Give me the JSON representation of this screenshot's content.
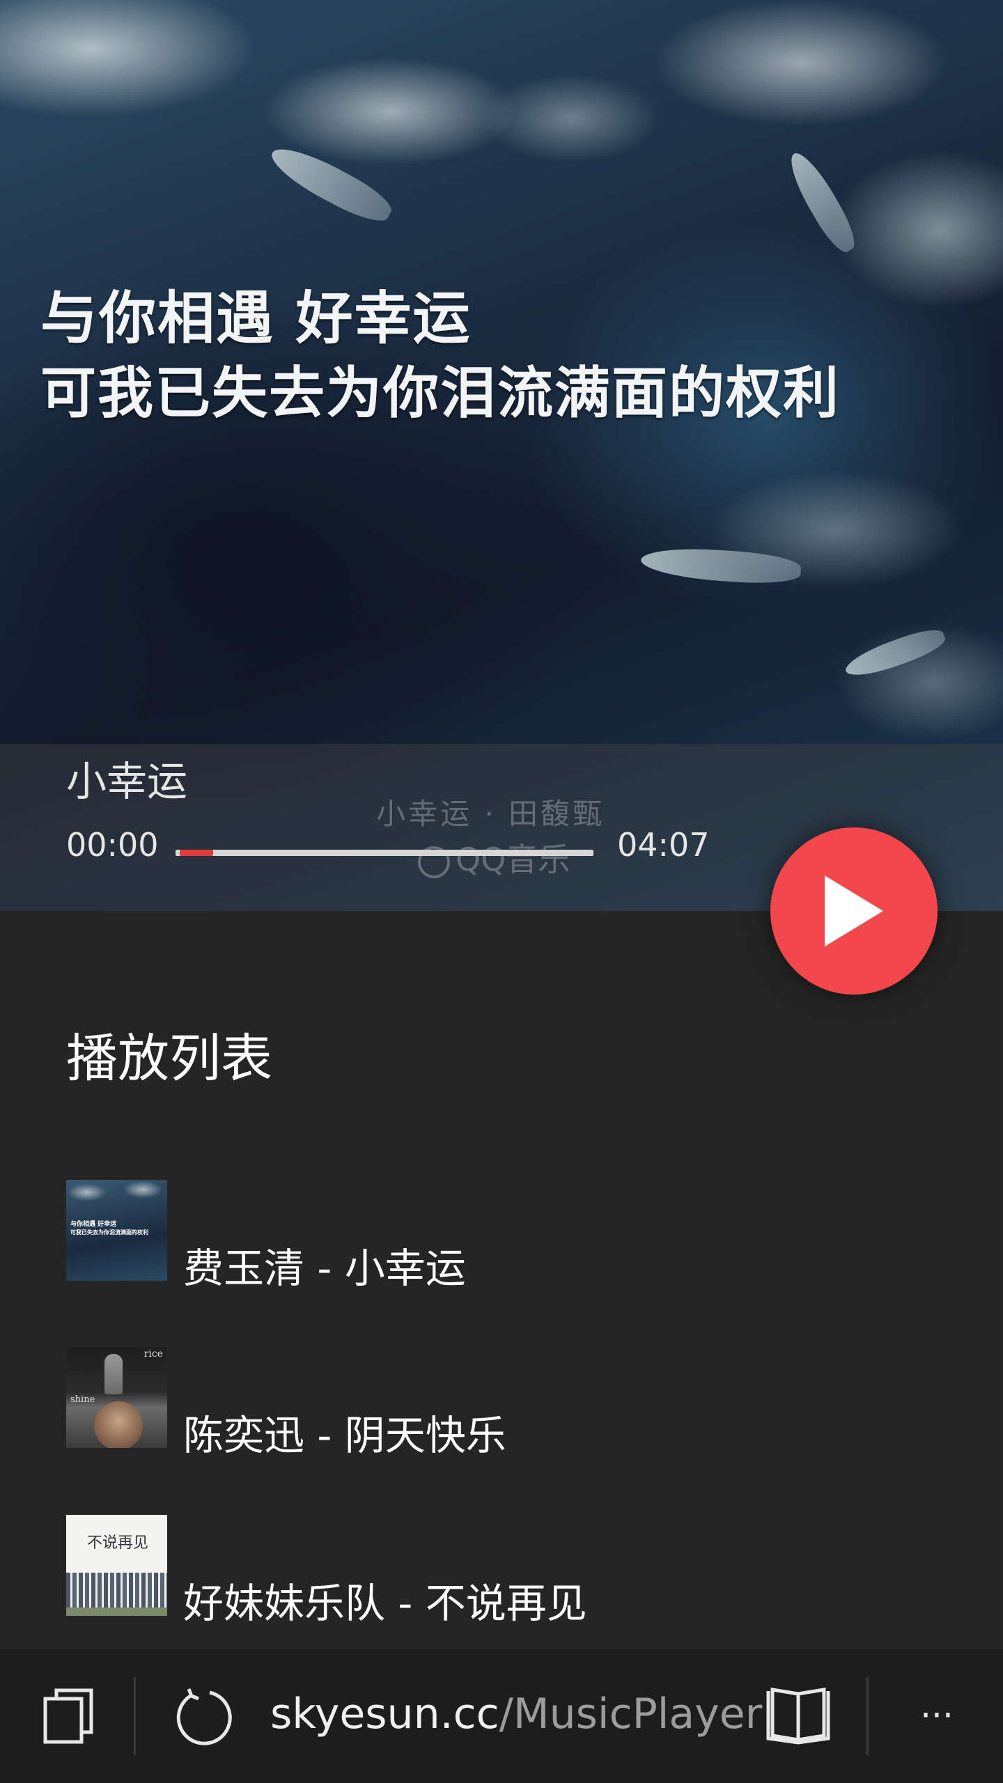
{
  "hero": {
    "lyric_line1": "与你相遇 好幸运",
    "lyric_line2": "可我已失去为你泪流满面的权利",
    "watermark_title": "小幸运 · 田馥甄",
    "watermark_brand": "QQ音乐"
  },
  "player": {
    "track_title": "小幸运",
    "current_time": "00:00",
    "duration": "04:07",
    "progress_fraction": 0.08,
    "play_icon": "play-icon",
    "accent_color": "#f2484b"
  },
  "playlist": {
    "heading": "播放列表",
    "items": [
      {
        "label": "费玉清 - 小幸运",
        "thumb_line1": "与你相遇 好幸运",
        "thumb_line2": "可我已失去为你泪流满面的权利"
      },
      {
        "label": "陈奕迅 - 阴天快乐",
        "thumb_text_top": "rice",
        "thumb_text_mid": "shine"
      },
      {
        "label": "好妹妹乐队 - 不说再见",
        "thumb_title": "不说再见"
      }
    ]
  },
  "browser": {
    "url_domain": "skyesun.cc",
    "url_path": "/MusicPlayer",
    "icons": [
      "tabs-icon",
      "refresh-icon",
      "reading-view-icon",
      "more-icon"
    ],
    "more_label": "···"
  }
}
